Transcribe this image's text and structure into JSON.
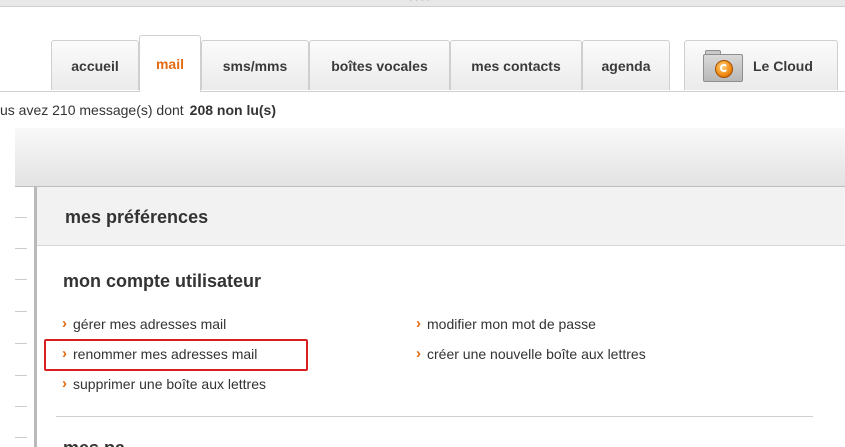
{
  "tabs": [
    {
      "label": "accueil",
      "active": false
    },
    {
      "label": "mail",
      "active": true
    },
    {
      "label": "sms/mms",
      "active": false
    },
    {
      "label": "boîtes vocales",
      "active": false
    },
    {
      "label": "mes contacts",
      "active": false
    },
    {
      "label": "agenda",
      "active": false
    }
  ],
  "cloud_tab": {
    "label": "Le Cloud",
    "icon": "cloud-folder-icon"
  },
  "message_summary": {
    "text": "us avez 210 message(s) dont",
    "unread": "208 non lu(s)"
  },
  "preferences": {
    "title": "mes préférences",
    "section": "mon compte utilisateur",
    "links_left": [
      "gérer mes adresses mail",
      "renommer mes adresses mail",
      "supprimer une boîte aux lettres"
    ],
    "links_right": [
      "modifier mon mot de passe",
      "créer une nouvelle boîte aux lettres"
    ],
    "highlighted_link": "renommer mes adresses mail",
    "next_section_cutoff": "mes pa"
  },
  "colors": {
    "accent": "#e36a12",
    "highlight_border": "#d62020",
    "text": "#333333"
  }
}
